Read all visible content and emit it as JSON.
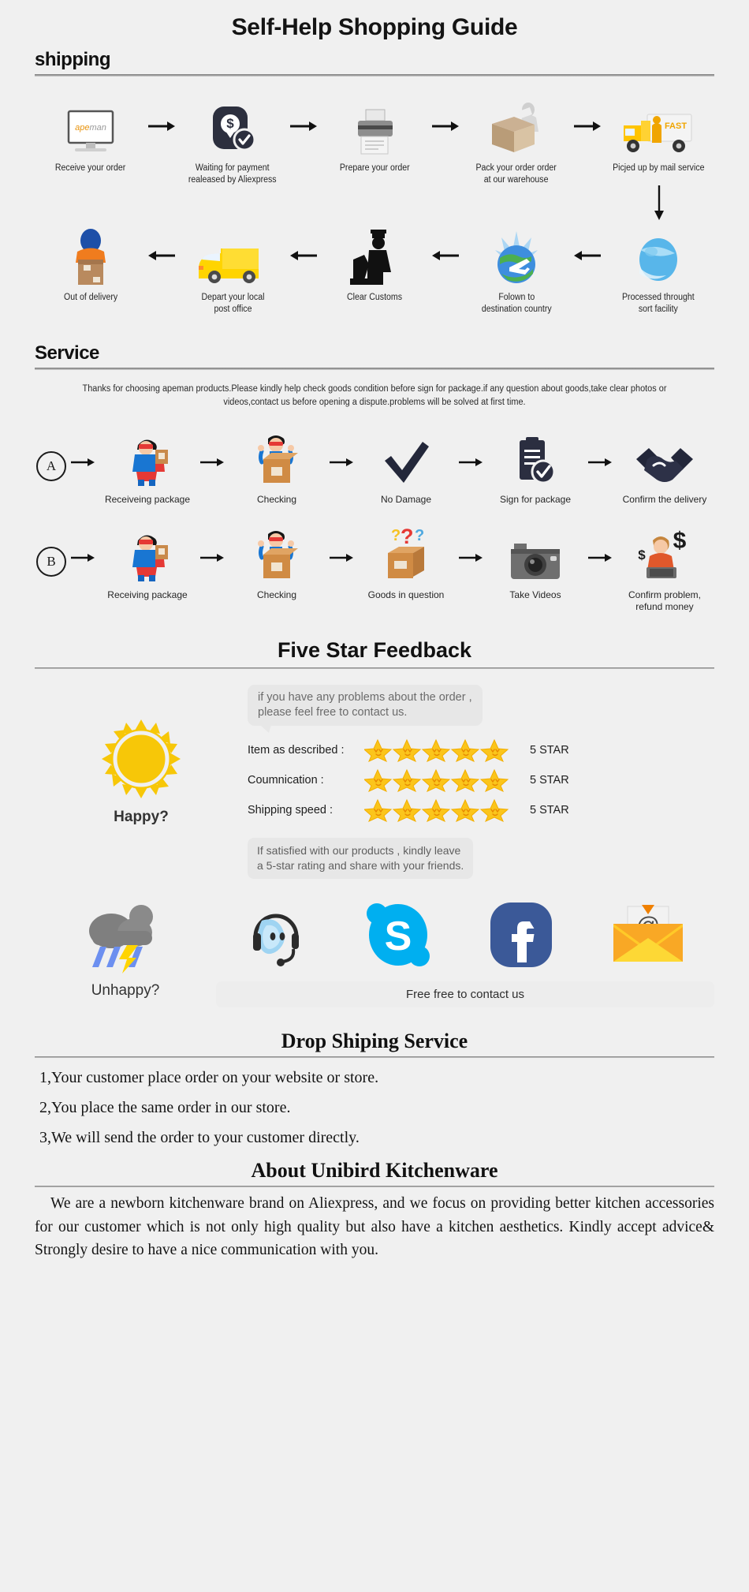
{
  "header": {
    "title": "Self-Help Shopping Guide"
  },
  "shipping": {
    "section_title": "shipping",
    "row1": [
      {
        "caption": "Receive your order",
        "icon": "monitor-apeman-icon",
        "logo": "apeman"
      },
      {
        "caption": "Waiting for payment\nrealeased by Aliexpress",
        "icon": "payment-shield-dollar-icon"
      },
      {
        "caption": "Prepare your order",
        "icon": "printer-icon"
      },
      {
        "caption": "Pack your order order\nat our warehouse",
        "icon": "worker-packing-box-icon"
      },
      {
        "caption": "Picjed up by mail service",
        "icon": "fast-delivery-truck-icon"
      }
    ],
    "row2": [
      {
        "caption": "Out of delivery",
        "icon": "courier-carrying-box-icon"
      },
      {
        "caption": "Depart your local\npost office",
        "icon": "yellow-van-icon"
      },
      {
        "caption": "Clear Customs",
        "icon": "customs-officer-icon"
      },
      {
        "caption": "Folown to\ndestination country",
        "icon": "globe-airplane-icon"
      },
      {
        "caption": "Processed throught\nsort facility",
        "icon": "blue-globe-icon"
      }
    ]
  },
  "service": {
    "section_title": "Service",
    "note": "Thanks for choosing apeman products.Please kindly help check goods condition before sign for package.if any question about goods,take clear photos or videos,contact us before opening a dispute.problems will be solved at first time.",
    "rowA": {
      "badge": "A",
      "steps": [
        {
          "caption": "Receiveing package",
          "icon": "superhero-holding-parcel-icon"
        },
        {
          "caption": "Checking",
          "icon": "person-opening-box-icon"
        },
        {
          "caption": "No Damage",
          "icon": "checkmark-icon"
        },
        {
          "caption": "Sign for package",
          "icon": "signed-document-icon"
        },
        {
          "caption": "Confirm the delivery",
          "icon": "handshake-icon"
        }
      ]
    },
    "rowB": {
      "badge": "B",
      "steps": [
        {
          "caption": "Receiving package",
          "icon": "superhero-holding-parcel-icon"
        },
        {
          "caption": "Checking",
          "icon": "person-opening-box-icon"
        },
        {
          "caption": "Goods in question",
          "icon": "box-with-question-marks-icon"
        },
        {
          "caption": "Take Videos",
          "icon": "camera-icon"
        },
        {
          "caption": "Confirm problem,\nrefund money",
          "icon": "support-agent-refund-icon"
        }
      ]
    }
  },
  "feedback": {
    "title": "Five Star Feedback",
    "happy_label": "Happy?",
    "happy_icon": "sun-icon",
    "bubble_top": "if you have any problems about the order ,\nplease feel free to contact us.",
    "ratings": [
      {
        "label": "Item as described :",
        "stars": 5,
        "value": "5 STAR"
      },
      {
        "label": "Coumnication :",
        "stars": 5,
        "value": "5 STAR"
      },
      {
        "label": "Shipping speed :",
        "stars": 5,
        "value": "5 STAR"
      }
    ],
    "bubble_bottom": "If satisfied with our products ,  kindly leave\na 5-star rating and share with your friends.",
    "unhappy_label": "Unhappy?",
    "unhappy_icon": "storm-cloud-icon",
    "socials": [
      {
        "name": "live-chat-headset-icon",
        "label": "Live Chat"
      },
      {
        "name": "skype-icon",
        "label": "Skype"
      },
      {
        "name": "facebook-icon",
        "label": "Facebook"
      },
      {
        "name": "email-icon",
        "label": "Email"
      }
    ],
    "contact_bar": "Free free to contact us"
  },
  "dropshipping": {
    "title": "Drop Shiping Service",
    "items": [
      "1,Your customer place order on your website or store.",
      "2,You place the same order in our store.",
      "3,We will send the order to your customer directly."
    ]
  },
  "about": {
    "title": "About Unibird Kitchenware",
    "body": "We are a newborn kitchenware brand on Aliexpress, and we focus on providing better kitchen accessories for our customer which is not only high quality but also have a kitchen aesthetics. Kindly accept advice& Strongly desire to have a nice communication with you."
  },
  "colors": {
    "background": "#f0f0f0",
    "accent_yellow": "#f5c518",
    "skype_blue": "#00aff0",
    "facebook_blue": "#3b5998",
    "email_yellow": "#f7c325",
    "dark_navy": "#2c2f3e"
  }
}
